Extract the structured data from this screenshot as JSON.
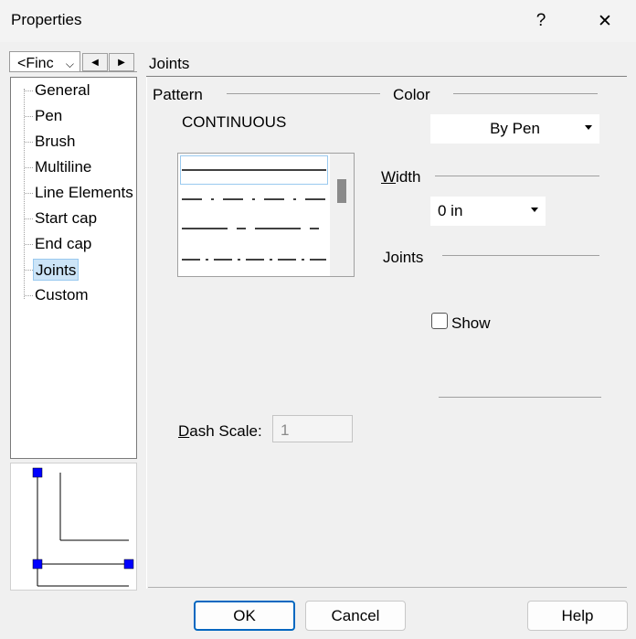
{
  "window": {
    "title": "Properties",
    "help_glyph": "?",
    "close_glyph": "✕"
  },
  "left": {
    "combo_value": "<Finc",
    "nav_prev": "◀",
    "nav_next": "▶",
    "tree_items": [
      {
        "label": "General"
      },
      {
        "label": "Pen"
      },
      {
        "label": "Brush"
      },
      {
        "label": "Multiline"
      },
      {
        "label": "Line Elements"
      },
      {
        "label": "Start cap"
      },
      {
        "label": "End cap"
      },
      {
        "label": "Joints",
        "selected": true
      },
      {
        "label": "Custom"
      }
    ]
  },
  "panel": {
    "heading": "Joints",
    "pattern_label": "Pattern",
    "pattern_value": "CONTINUOUS",
    "color_label": "Color",
    "color_value": "By Pen",
    "width_label_prefix": "W",
    "width_label_rest": "idth",
    "width_value": "0 in",
    "joints_label": "Joints",
    "show_label": "Show",
    "show_checked": false,
    "dash_scale_prefix": "D",
    "dash_scale_rest": "ash Scale:",
    "dash_scale_value": "1"
  },
  "buttons": {
    "ok": "OK",
    "cancel": "Cancel",
    "help": "Help"
  },
  "colors": {
    "accent": "#0067c0",
    "selection": "#cce4f7",
    "handle": "#0000ff"
  }
}
